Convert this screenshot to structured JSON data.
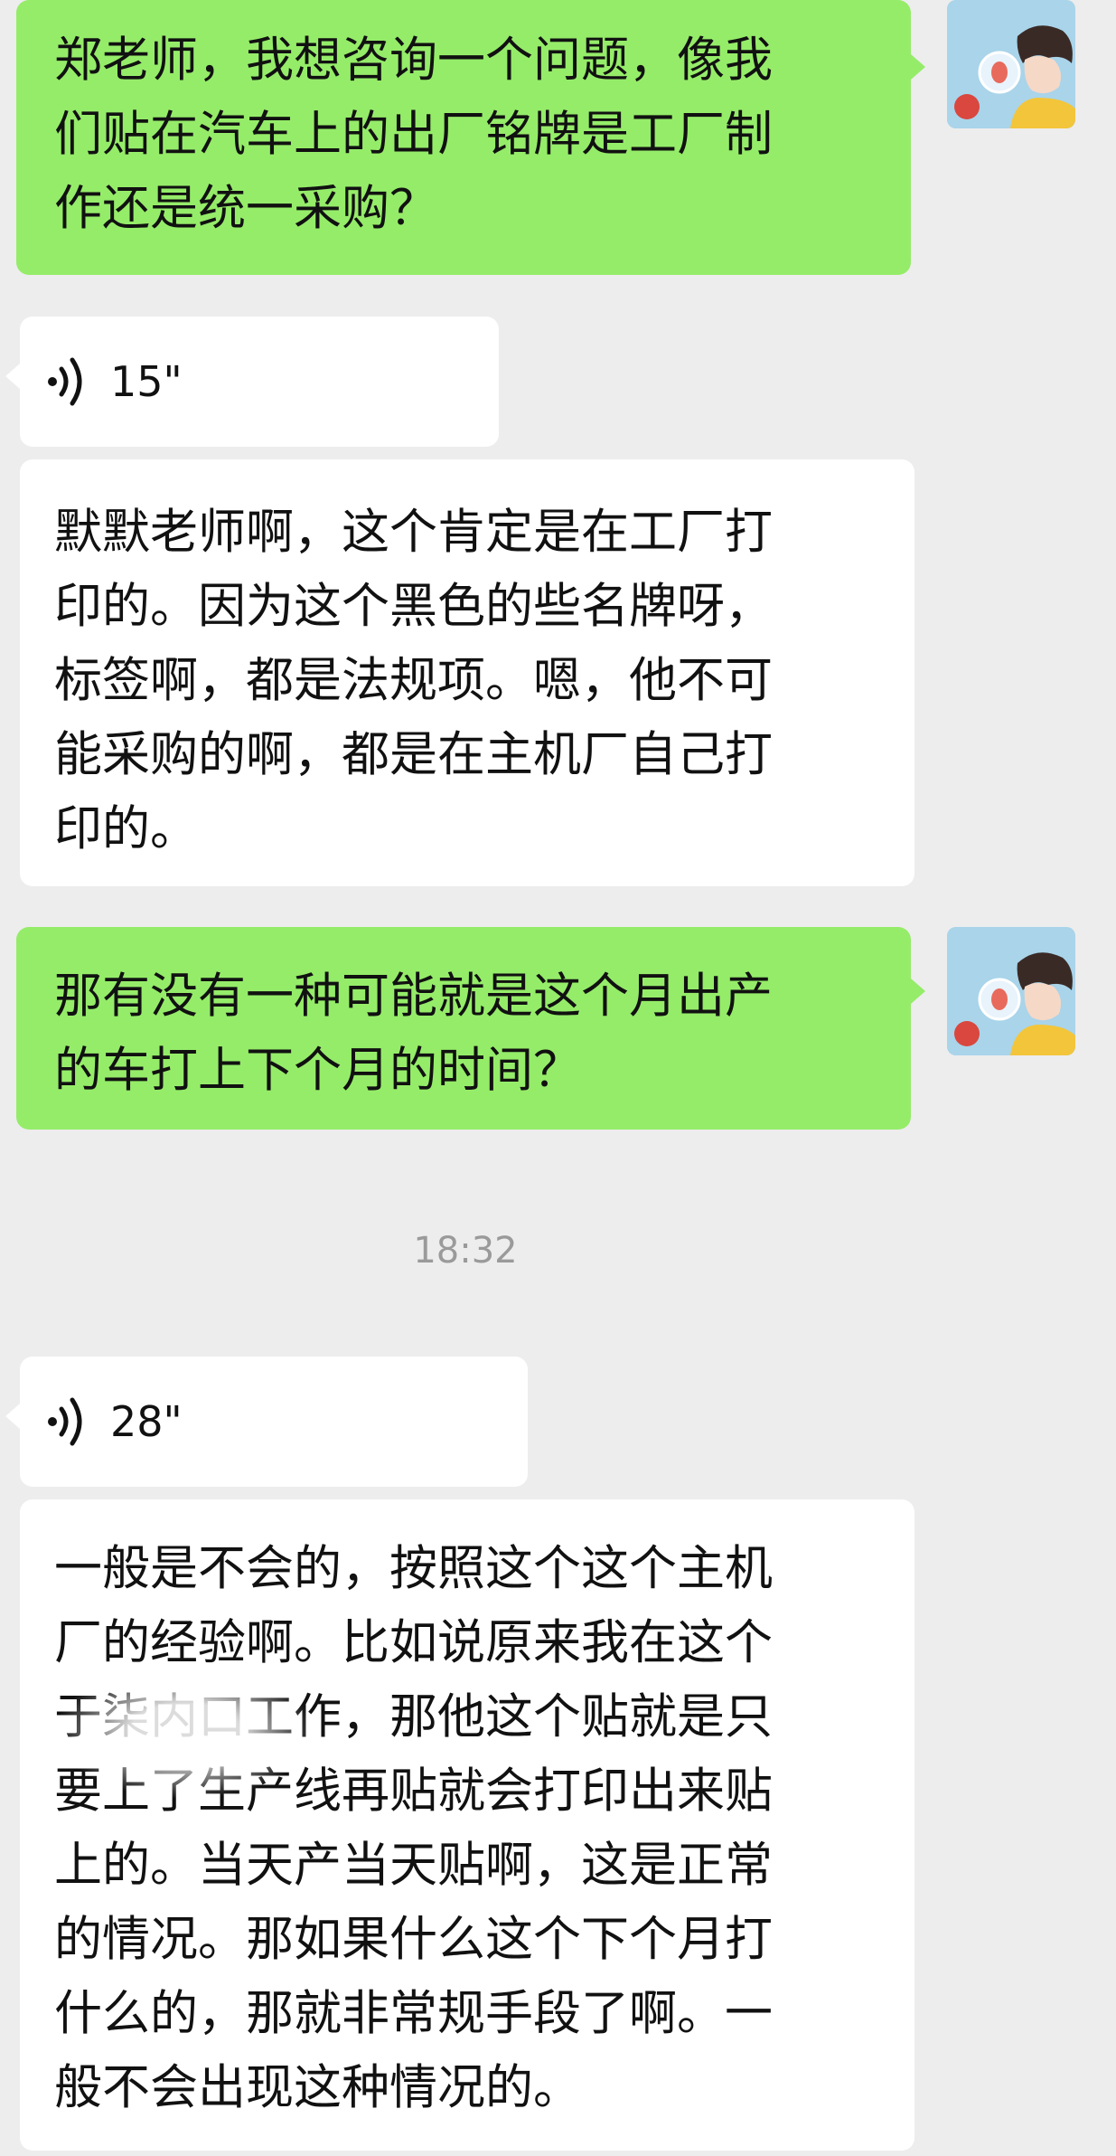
{
  "messages": [
    {
      "type": "text",
      "from": "me",
      "lines": [
        "郑老师，我想咨询一个问题，像我",
        "们贴在汽车上的出厂铭牌是工厂制",
        "作还是统一采购？"
      ]
    },
    {
      "type": "voice",
      "from": "them",
      "duration": "15\""
    },
    {
      "type": "text",
      "from": "them",
      "lines": [
        "默默老师啊，这个肯定是在工厂打",
        "印的。因为这个黑色的些名牌呀，",
        "标签啊，都是法规项。嗯，他不可",
        "能采购的啊，都是在主机厂自己打",
        "印的。"
      ]
    },
    {
      "type": "text",
      "from": "me",
      "lines": [
        "那有没有一种可能就是这个月出产",
        "的车打上下个月的时间？"
      ]
    },
    {
      "type": "time",
      "label": "18:32"
    },
    {
      "type": "voice",
      "from": "them",
      "duration": "28\""
    },
    {
      "type": "text",
      "from": "them",
      "lines": [
        "一般是不会的，按照这个这个主机",
        "厂的经验啊。比如说原来我在这个",
        "于柒内口工作，那他这个贴就是只",
        "要上了生产线再贴就会打印出来贴",
        "上的。当天产当天贴啊，这是正常",
        "的情况。那如果什么这个下个月打",
        "什么的，那就非常规手段了啊。一",
        "般不会出现这种情况的。"
      ]
    }
  ],
  "colors": {
    "me_bubble": "#95ec69",
    "them_bubble": "#ffffff",
    "background": "#ededed",
    "timestamp": "#9a9a9a"
  },
  "icons": {
    "voice": "voice-wave-icon",
    "avatar": "avatar-anime-girl"
  }
}
